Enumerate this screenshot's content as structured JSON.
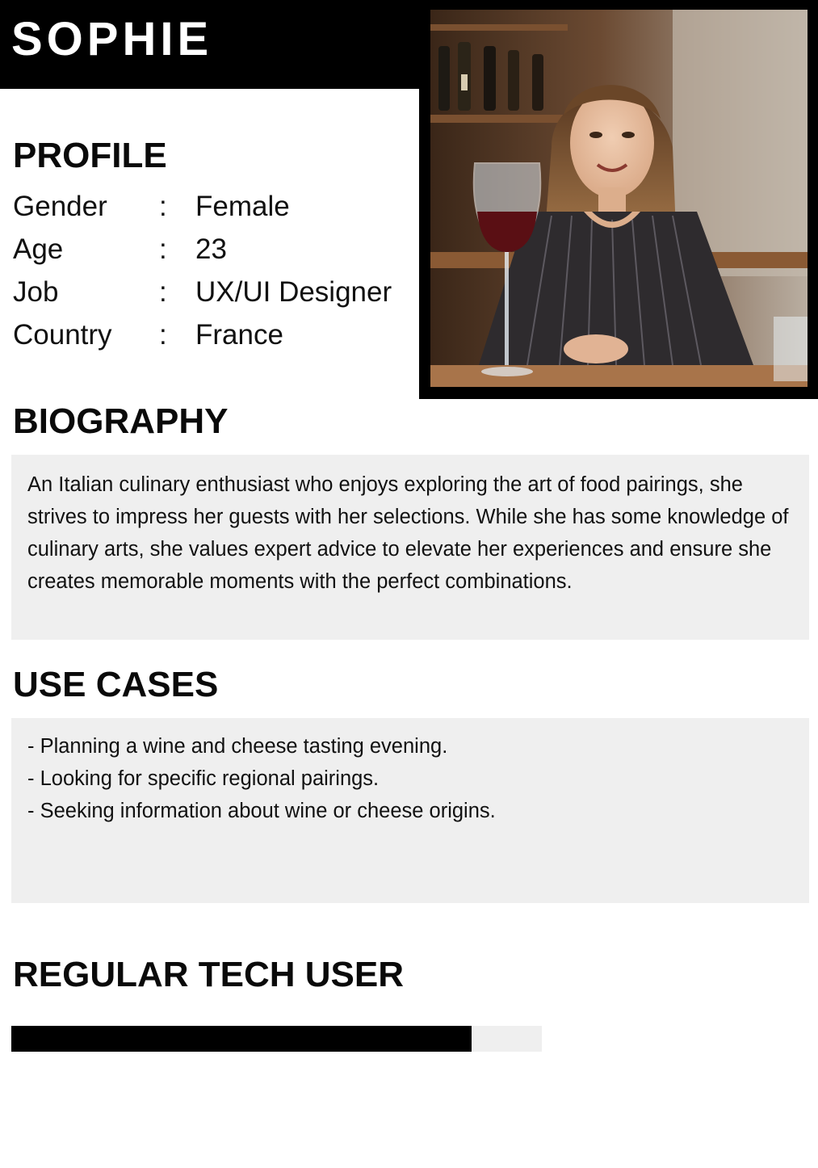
{
  "persona": {
    "name": "SOPHIE"
  },
  "profile": {
    "title": "PROFILE",
    "separator": ":",
    "fields": [
      {
        "label": "Gender",
        "value": "Female"
      },
      {
        "label": "Age",
        "value": "23"
      },
      {
        "label": "Job",
        "value": "UX/UI Designer"
      },
      {
        "label": "Country",
        "value": "France"
      }
    ]
  },
  "biography": {
    "title": "BIOGRAPHY",
    "text": "An Italian culinary enthusiast who enjoys exploring the art of food pairings, she strives to impress her guests with her selections. While she has some knowledge of culinary arts, she values expert advice to elevate her experiences and ensure she creates memorable moments with the perfect combinations."
  },
  "use_cases": {
    "title": "USE CASES",
    "items": [
      "- Planning a wine and cheese tasting evening.",
      "- Looking for specific regional pairings.",
      "- Seeking information about wine or cheese origins."
    ]
  },
  "tech": {
    "title": "REGULAR TECH USER",
    "level": 0.868
  },
  "colors": {
    "banner": "#000000",
    "box": "#efefef",
    "bar_fill": "#000000",
    "bar_track": "#efefef"
  }
}
